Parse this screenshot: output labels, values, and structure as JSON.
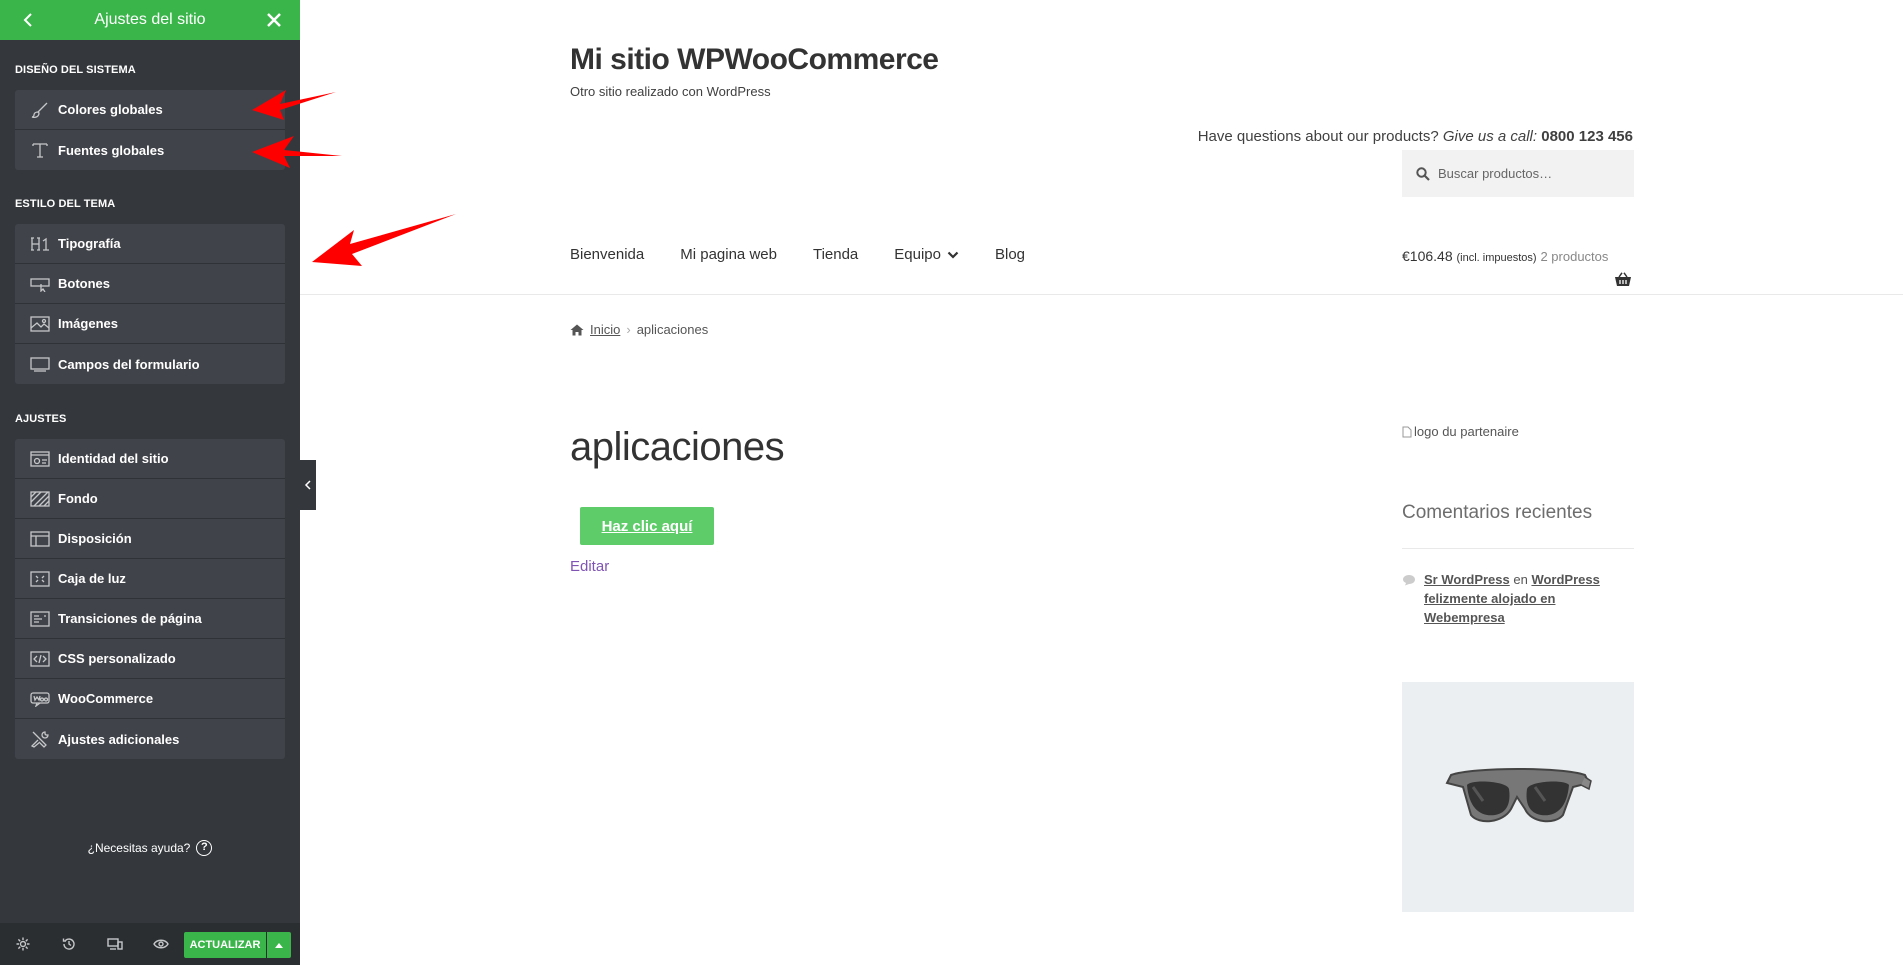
{
  "panel": {
    "title": "Ajustes del sitio",
    "sections": [
      {
        "title": "DISEÑO DEL SISTEMA",
        "items": [
          {
            "label": "Colores globales",
            "icon": "brush-icon"
          },
          {
            "label": "Fuentes globales",
            "icon": "type-icon"
          }
        ]
      },
      {
        "title": "ESTILO DEL TEMA",
        "items": [
          {
            "label": "Tipografía",
            "icon": "heading-icon"
          },
          {
            "label": "Botones",
            "icon": "button-icon"
          },
          {
            "label": "Imágenes",
            "icon": "image-icon"
          },
          {
            "label": "Campos del formulario",
            "icon": "form-field-icon"
          }
        ]
      },
      {
        "title": "AJUSTES",
        "items": [
          {
            "label": "Identidad del sitio",
            "icon": "site-identity-icon"
          },
          {
            "label": "Fondo",
            "icon": "background-icon"
          },
          {
            "label": "Disposición",
            "icon": "layout-icon"
          },
          {
            "label": "Caja de luz",
            "icon": "lightbox-icon"
          },
          {
            "label": "Transiciones de página",
            "icon": "transitions-icon"
          },
          {
            "label": "CSS personalizado",
            "icon": "code-icon"
          },
          {
            "label": "WooCommerce",
            "icon": "woo-icon"
          },
          {
            "label": "Ajustes adicionales",
            "icon": "tools-icon"
          }
        ]
      }
    ],
    "help": "¿Necesitas ayuda?",
    "help_icon": "?",
    "update_label": "ACTUALIZAR"
  },
  "site": {
    "title": "Mi sitio WPWooCommerce",
    "tagline": "Otro sitio realizado con WordPress",
    "header_msg_prefix": "Have questions about our products? ",
    "header_msg_em": "Give us a call:",
    "header_msg_phone": " 0800 123 456",
    "search_placeholder": "Buscar productos…",
    "nav": [
      "Bienvenida",
      "Mi pagina web",
      "Tienda",
      "Equipo",
      "Blog"
    ],
    "cart_amount": "€106.48",
    "cart_tax": "(incl. impuestos)",
    "cart_count": "2 productos",
    "breadcrumb_home": "Inicio",
    "breadcrumb_current": "aplicaciones",
    "page_title": "aplicaciones",
    "cta_label": "Haz clic aquí",
    "edit_label": "Editar",
    "partner_alt": "logo du partenaire",
    "widget_title": "Comentarios recientes",
    "comment_author": "Sr WordPress",
    "comment_in": " en ",
    "comment_post": "WordPress felizmente alojado en Webempresa"
  },
  "colors": {
    "panel_bg": "#34383c",
    "panel_header": "#39b54a",
    "cta": "#5fcc6a",
    "edit_link": "#7f54b3",
    "arrow": "#ff0000"
  }
}
